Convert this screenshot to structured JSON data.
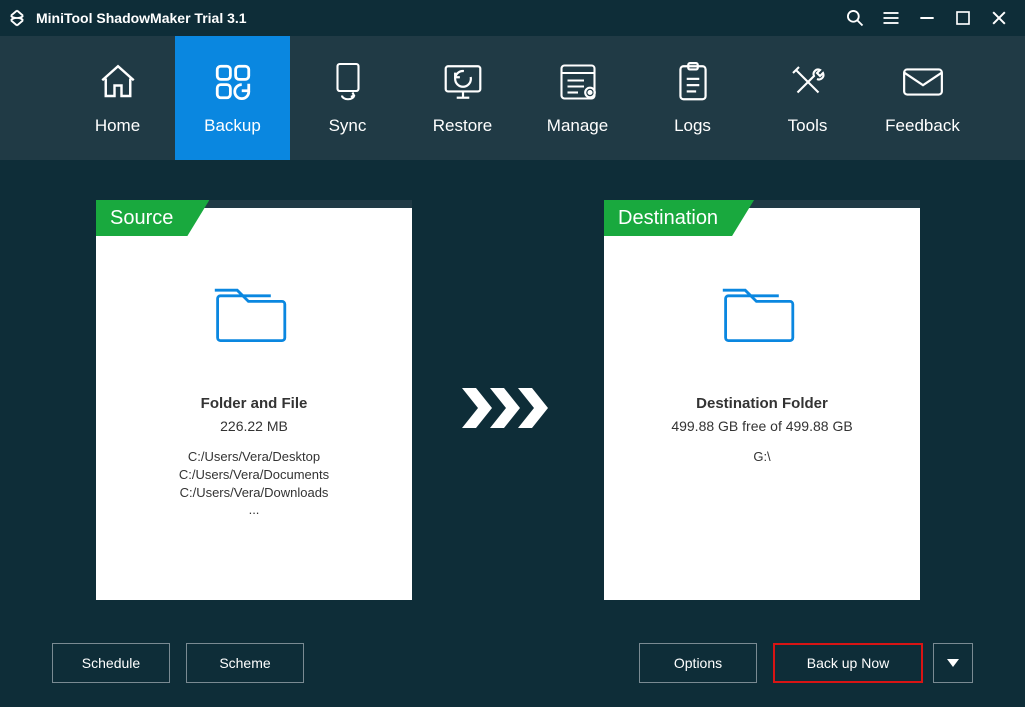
{
  "titlebar": {
    "app_title": "MiniTool ShadowMaker Trial 3.1"
  },
  "nav": {
    "items": [
      {
        "label": "Home"
      },
      {
        "label": "Backup"
      },
      {
        "label": "Sync"
      },
      {
        "label": "Restore"
      },
      {
        "label": "Manage"
      },
      {
        "label": "Logs"
      },
      {
        "label": "Tools"
      },
      {
        "label": "Feedback"
      }
    ],
    "active": "Backup"
  },
  "source": {
    "banner": "Source",
    "title": "Folder and File",
    "size": "226.22 MB",
    "paths": [
      "C:/Users/Vera/Desktop",
      "C:/Users/Vera/Documents",
      "C:/Users/Vera/Downloads"
    ],
    "more": "..."
  },
  "destination": {
    "banner": "Destination",
    "title": "Destination Folder",
    "free_space": "499.88 GB free of 499.88 GB",
    "path": "G:\\"
  },
  "footer": {
    "schedule": "Schedule",
    "scheme": "Scheme",
    "options": "Options",
    "backup_now": "Back up Now"
  }
}
